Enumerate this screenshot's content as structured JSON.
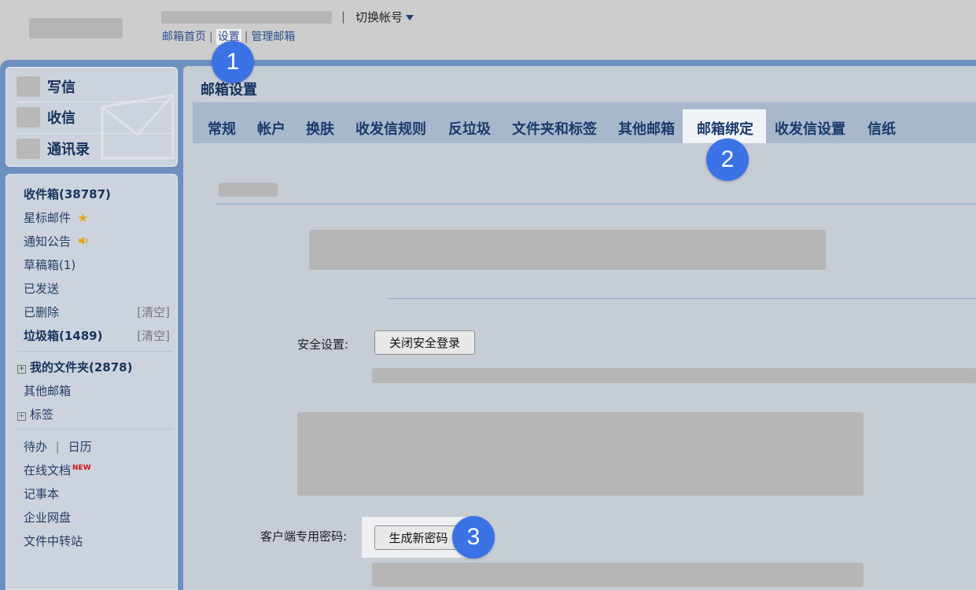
{
  "topbar": {
    "switch_account": "切换帐号",
    "separator": "|",
    "links": [
      "邮箱首页",
      "设置",
      "管理邮箱"
    ]
  },
  "sidebar": {
    "commands": [
      "写信",
      "收信",
      "通讯录"
    ],
    "folders": [
      {
        "label": "收件箱(38787)",
        "bold": true
      },
      {
        "label": "星标邮件",
        "bold": false
      },
      {
        "label": "通知公告",
        "bold": false
      },
      {
        "label": "草稿箱(1)",
        "bold": false
      },
      {
        "label": "已发送",
        "bold": false
      },
      {
        "label": "已删除",
        "bold": false,
        "action": "[清空]"
      },
      {
        "label": "垃圾箱(1489)",
        "bold": true,
        "action": "[清空]"
      }
    ],
    "my_folders": "我的文件夹(2878)",
    "other_mailbox": "其他邮箱",
    "tags": "标签",
    "todo": "待办",
    "calendar": "日历",
    "online_docs": "在线文档",
    "new_badge": "NEW",
    "notepad": "记事本",
    "netdisk": "企业网盘",
    "file_transfer": "文件中转站"
  },
  "main": {
    "title": "邮箱设置",
    "tabs": [
      "常规",
      "帐户",
      "换肤",
      "收发信规则",
      "反垃圾",
      "文件夹和标签",
      "其他邮箱",
      "邮箱绑定",
      "收发信设置",
      "信纸"
    ],
    "active_tab": "邮箱绑定",
    "security_label": "安全设置:",
    "security_button": "关闭安全登录",
    "client_pwd_label": "客户端专用密码:",
    "client_pwd_button": "生成新密码"
  },
  "annotations": [
    "1",
    "2",
    "3"
  ],
  "colors": {
    "accent_badge": "#3b72e6",
    "frame_blue": "#6e90c0",
    "nav_text": "#17325e",
    "new_red": "#d0141c"
  }
}
